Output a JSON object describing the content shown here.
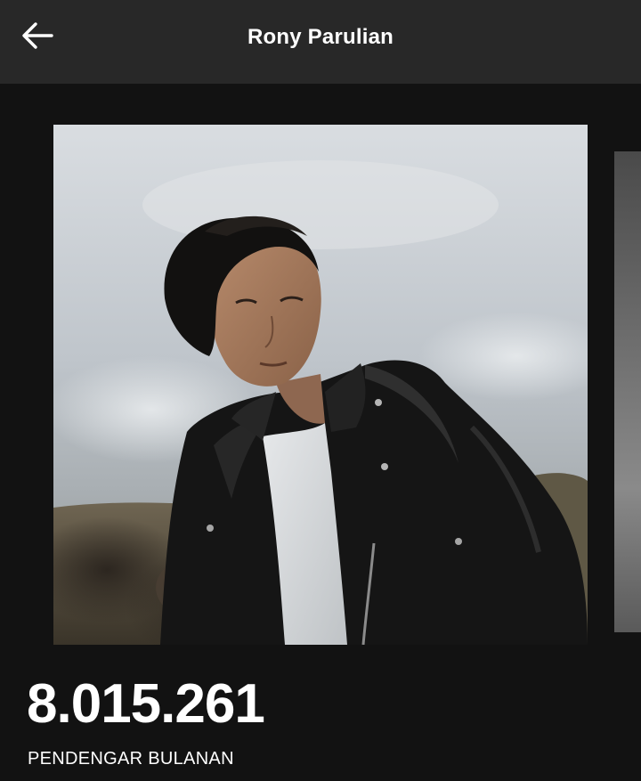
{
  "header": {
    "title": "Rony Parulian",
    "back_icon": "arrow-left-icon"
  },
  "gallery": {
    "photo_description": "artist-photo",
    "next_photo": "artist-photo-next"
  },
  "stats": {
    "monthly_listeners": "8.015.261",
    "monthly_listeners_label": "PENDENGAR BULANAN"
  },
  "colors": {
    "background": "#121212",
    "header_background": "#282828",
    "text": "#ffffff"
  }
}
